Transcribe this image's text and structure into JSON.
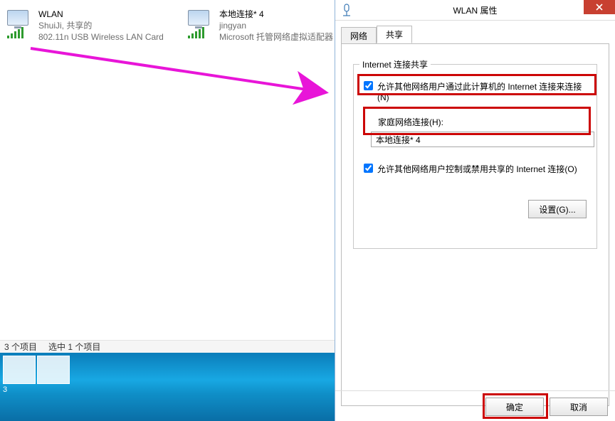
{
  "connections": [
    {
      "name": "WLAN",
      "line2": "ShuiJi, 共享的",
      "line3": "802.11n USB Wireless LAN Card"
    },
    {
      "name": "本地连接* 4",
      "line2": "jingyan",
      "line3": "Microsoft 托管网络虚拟适配器"
    }
  ],
  "statusbar": {
    "count": "3 个项目",
    "selected": "选中 1 个项目"
  },
  "taskbar": {
    "badge": "3"
  },
  "dialog": {
    "title": "WLAN 属性",
    "tabs": {
      "network": "网络",
      "sharing": "共享"
    },
    "group_title": "Internet 连接共享",
    "allow_share": "允许其他网络用户通过此计算机的 Internet 连接来连接(N)",
    "home_net_label": "家庭网络连接(H):",
    "home_net_value": "本地连接* 4",
    "allow_control": "允许其他网络用户控制或禁用共享的 Internet 连接(O)",
    "settings_btn": "设置(G)...",
    "ok": "确定",
    "cancel": "取消"
  }
}
